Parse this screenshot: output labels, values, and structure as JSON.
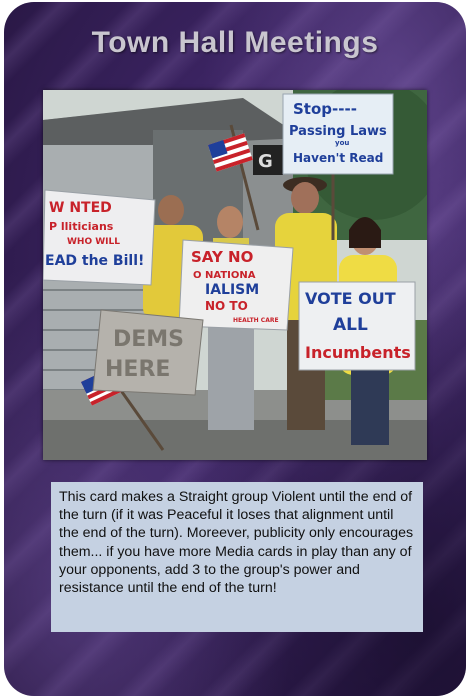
{
  "card": {
    "title": "Town Hall Meetings",
    "rules_text": "This card makes a Straight group Violent until the end of the turn (if it was Peaceful it loses that alignment until the end of the turn).  Moreever, publicity only encourages them... if you have more Media cards in play than any of your opponents, add 3 to the group's power and resistance until the end of the turn!"
  },
  "signs": {
    "stop_line1": "Stop----",
    "stop_line2": "Passing Laws",
    "stop_line3": "you",
    "stop_line4": "Haven't Read",
    "wanted_line1": "W NTED",
    "wanted_line2": "P lliticians",
    "wanted_line3": "WHO WILL",
    "wanted_line4": "EAD the Bill!",
    "say_line1": "SAY NO",
    "say_line2": "O NATIONA",
    "say_line3": "IALISM",
    "say_line4": "NO TO",
    "say_line5": "HEALTH CARE",
    "vote_line1": "VOTE OUT",
    "vote_line2": "ALL",
    "vote_line3": "Incumbents",
    "dems_line1": "DEMS",
    "dems_line2": "HERE"
  },
  "colors": {
    "card_purple": "#3a2360",
    "title_text": "#c9c6cf",
    "text_box": "#c5d1e2",
    "sign_red": "#c8222a",
    "sign_blue": "#1f3f9a",
    "shirt_yellow": "#e9d43a"
  }
}
